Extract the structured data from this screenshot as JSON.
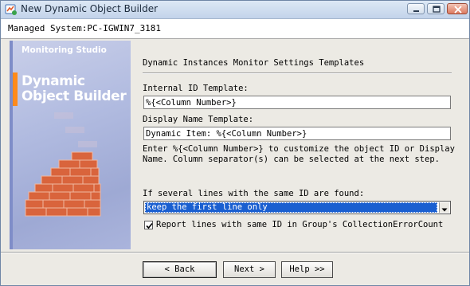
{
  "window": {
    "title": "New Dynamic Object Builder",
    "title_icon": "app-icon",
    "controls": {
      "minimize": "minimize-icon",
      "restore": "restore-icon",
      "close": "close-icon"
    }
  },
  "header": {
    "managed_system": "Managed System:PC-IGWIN7_3181"
  },
  "banner": {
    "brand_small": "Monitoring Studio",
    "brand_title": "Dynamic Object Builder",
    "accent_color": "#ff8a1a",
    "brick_color": "#d9643c"
  },
  "panel": {
    "heading": "Dynamic Instances Monitor Settings Templates",
    "internal_id": {
      "label": "Internal ID Template:",
      "value": "%{<Column Number>}"
    },
    "display_name": {
      "label": "Display Name Template:",
      "value": "Dynamic Item: %{<Column Number>}"
    },
    "help_text": "Enter %{<Column Number>} to customize the object ID or Display Name. Column separator(s) can be selected at the next step.",
    "duplicate_label": "If several lines with the same ID are found:",
    "duplicate_selected": "keep the first line only",
    "report_checkbox": {
      "label": "Report lines with same ID in Group's CollectionErrorCount",
      "checked": true
    }
  },
  "footer": {
    "back_label": "< Back",
    "next_label": "Next >",
    "help_label": "Help >>"
  },
  "colors": {
    "selection": "#1a5fd0",
    "dialog_bg": "#eceae4"
  }
}
